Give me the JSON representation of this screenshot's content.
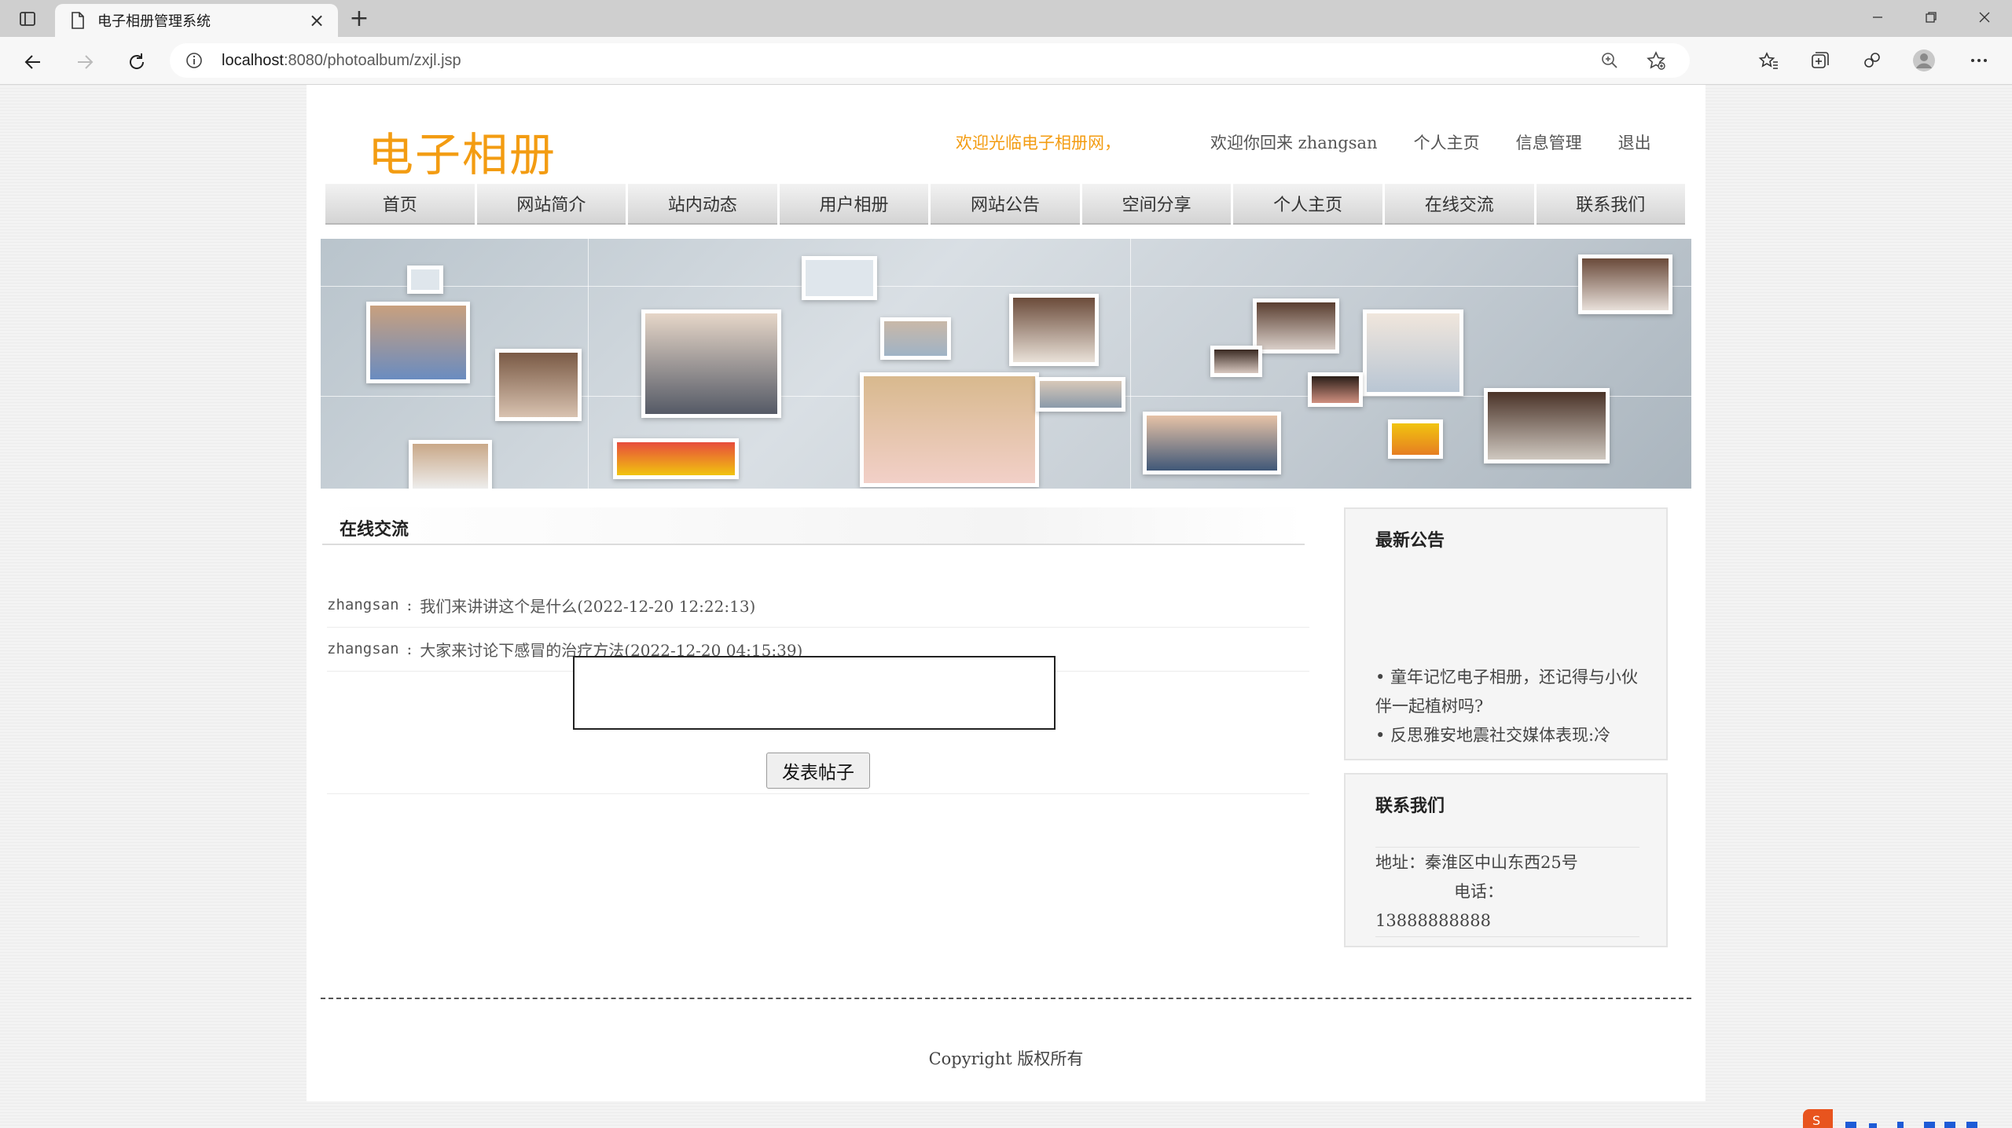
{
  "browser": {
    "tab_title": "电子相册管理系统",
    "url_host": "localhost",
    "url_rest": ":8080/photoalbum/zxjl.jsp"
  },
  "header": {
    "logo": "电子相册",
    "marquee": "欢迎光临电子相册网，",
    "greeting": "欢迎你回来 zhangsan",
    "links": [
      "个人主页",
      "信息管理",
      "退出"
    ]
  },
  "nav": {
    "items": [
      "首页",
      "网站简介",
      "站内动态",
      "用户相册",
      "网站公告",
      "空间分享",
      "个人主页",
      "在线交流",
      "联系我们"
    ]
  },
  "main": {
    "section_title": "在线交流",
    "posts": [
      {
        "user": "zhangsan",
        "text": "我们来讲讲这个是什么(2022-12-20 12:22:13)"
      },
      {
        "user": "zhangsan",
        "text": "大家来讨论下感冒的治疗方法(2022-12-20 04:15:39)"
      }
    ],
    "reply_value": "",
    "submit_label": "发表帖子"
  },
  "sidebar": {
    "notice_title": "最新公告",
    "notices": [
      "• 童年记忆电子相册，还记得与小伙伴一起植树吗?",
      "• 反思雅安地震社交媒体表现:冷"
    ],
    "contact_title": "联系我们",
    "address": "地址：秦淮区中山东西25号",
    "phone_label": "电话：",
    "phone": "13888888888"
  },
  "footer": {
    "copyright": "Copyright 版权所有"
  },
  "colors": {
    "accent": "#f39c12",
    "text": "#555555"
  }
}
